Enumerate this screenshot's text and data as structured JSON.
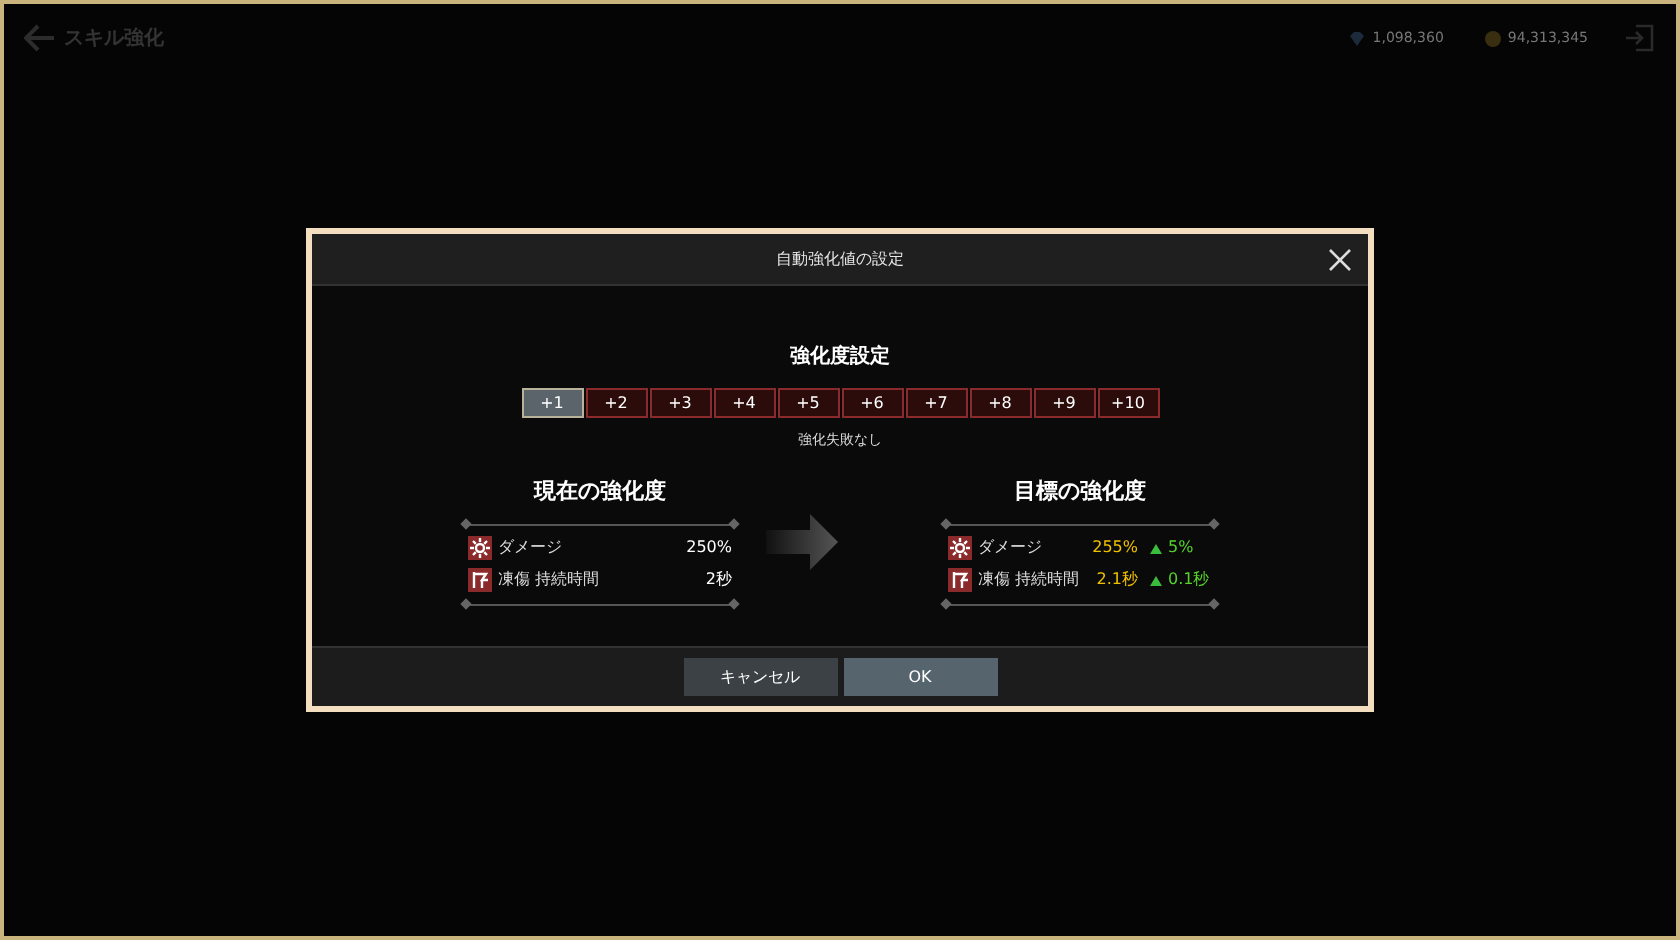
{
  "background": {
    "title": "スキル強化",
    "currencies": [
      {
        "kind": "gem",
        "amount": "1,098,360"
      },
      {
        "kind": "coin",
        "amount": "94,313,345"
      }
    ]
  },
  "dialog": {
    "title": "自動強化値の設定",
    "section_title": "強化度設定",
    "levels": [
      {
        "label": "+1",
        "selected": true
      },
      {
        "label": "+2",
        "selected": false
      },
      {
        "label": "+3",
        "selected": false
      },
      {
        "label": "+4",
        "selected": false
      },
      {
        "label": "+5",
        "selected": false
      },
      {
        "label": "+6",
        "selected": false
      },
      {
        "label": "+7",
        "selected": false
      },
      {
        "label": "+8",
        "selected": false
      },
      {
        "label": "+9",
        "selected": false
      },
      {
        "label": "+10",
        "selected": false
      }
    ],
    "note": "強化失敗なし",
    "current": {
      "title": "現在の強化度",
      "stats": [
        {
          "kind": "burst",
          "name": "ダメージ",
          "value": "250%"
        },
        {
          "kind": "frost",
          "name": "凍傷 持続時間",
          "value": "2秒"
        }
      ]
    },
    "target": {
      "title": "目標の強化度",
      "stats": [
        {
          "kind": "burst",
          "name": "ダメージ",
          "value": "255%",
          "increase": "5%"
        },
        {
          "kind": "frost",
          "name": "凍傷 持続時間",
          "value": "2.1秒",
          "increase": "0.1秒"
        }
      ]
    },
    "buttons": [
      {
        "label": "キャンセル",
        "kind": "secondary"
      },
      {
        "label": "OK",
        "kind": "primary"
      }
    ]
  }
}
